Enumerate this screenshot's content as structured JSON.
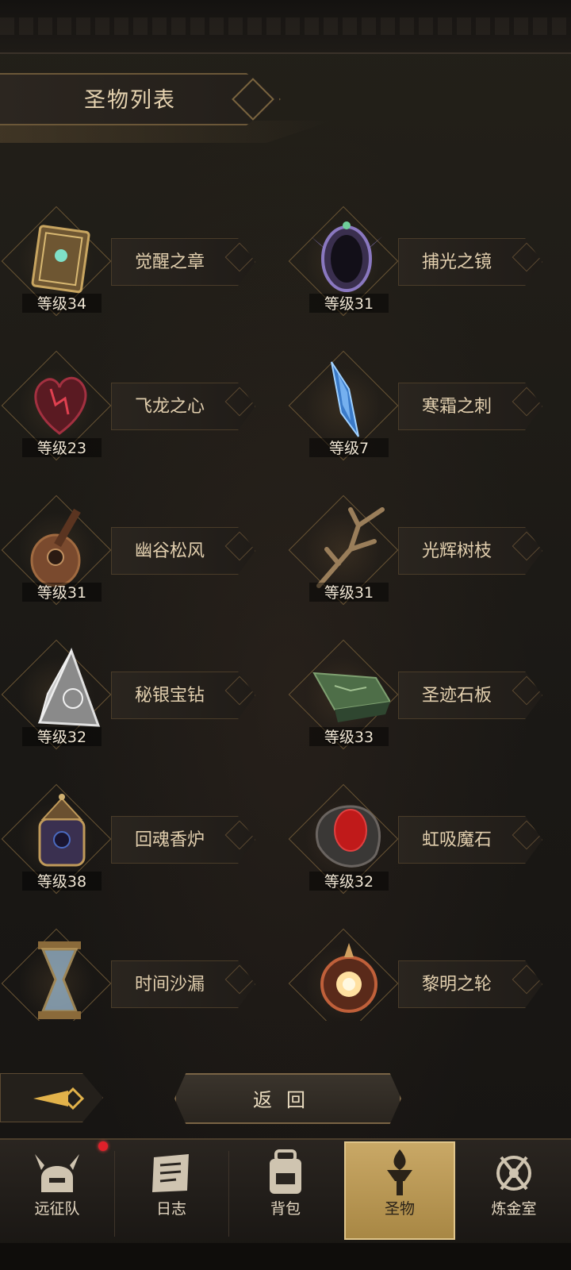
{
  "header": {
    "title": "圣物列表"
  },
  "relics": [
    {
      "name": "觉醒之章",
      "level": "等级34",
      "icon": "book-relic-icon"
    },
    {
      "name": "捕光之镜",
      "level": "等级31",
      "icon": "mirror-relic-icon"
    },
    {
      "name": "飞龙之心",
      "level": "等级23",
      "icon": "dragon-heart-relic-icon"
    },
    {
      "name": "寒霜之刺",
      "level": "等级7",
      "icon": "frost-shard-relic-icon"
    },
    {
      "name": "幽谷松风",
      "level": "等级31",
      "icon": "lute-relic-icon"
    },
    {
      "name": "光辉树枝",
      "level": "等级31",
      "icon": "branch-relic-icon"
    },
    {
      "name": "秘银宝钻",
      "level": "等级32",
      "icon": "pyramid-relic-icon"
    },
    {
      "name": "圣迹石板",
      "level": "等级33",
      "icon": "stone-tablet-relic-icon"
    },
    {
      "name": "回魂香炉",
      "level": "等级38",
      "icon": "censer-relic-icon"
    },
    {
      "name": "虹吸魔石",
      "level": "等级32",
      "icon": "red-gem-relic-icon"
    },
    {
      "name": "时间沙漏",
      "level": "",
      "icon": "hourglass-relic-icon"
    },
    {
      "name": "黎明之轮",
      "level": "",
      "icon": "dawn-wheel-relic-icon"
    }
  ],
  "back_button": {
    "label": "返回"
  },
  "nav": [
    {
      "label": "远征队",
      "icon": "helmet-icon",
      "active": false,
      "badge": true
    },
    {
      "label": "日志",
      "icon": "scroll-icon",
      "active": false,
      "badge": false
    },
    {
      "label": "背包",
      "icon": "backpack-icon",
      "active": false,
      "badge": false
    },
    {
      "label": "圣物",
      "icon": "torch-icon",
      "active": true,
      "badge": false
    },
    {
      "label": "炼金室",
      "icon": "alchemy-icon",
      "active": false,
      "badge": false
    }
  ],
  "colors": {
    "accent_gold": "#c9a866",
    "badge_red": "#e0202a",
    "frame_brown": "#6b5738"
  }
}
